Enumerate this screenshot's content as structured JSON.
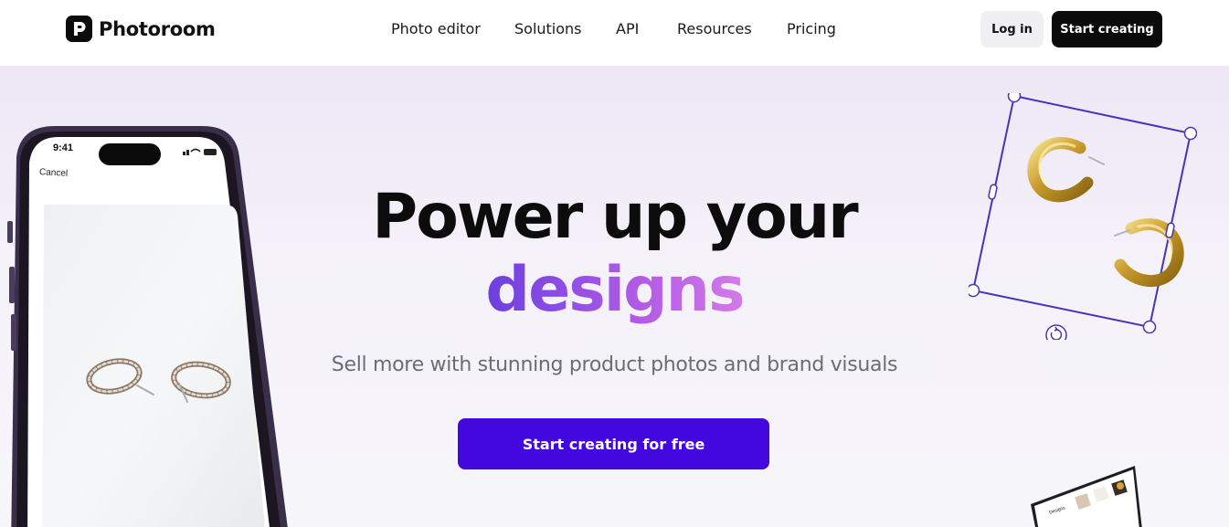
{
  "nav": {
    "brand": "Photoroom",
    "menu": [
      "Photo editor",
      "Solutions",
      "API",
      "Resources",
      "Pricing"
    ],
    "login_label": "Log in",
    "start_label": "Start creating"
  },
  "hero": {
    "title_line1": "Power up your",
    "title_line2": "designs",
    "subtitle": "Sell more with stunning product photos and brand visuals",
    "cta_label": "Start creating for free"
  },
  "phone": {
    "time": "9:41",
    "cancel_label": "Cancel"
  },
  "laptop": {
    "screen_title": "Designs"
  },
  "colors": {
    "accent": "#4308de",
    "gradient_start": "#6b3fe0",
    "gradient_end": "#d57ae8",
    "selection": "#4a32b8"
  }
}
